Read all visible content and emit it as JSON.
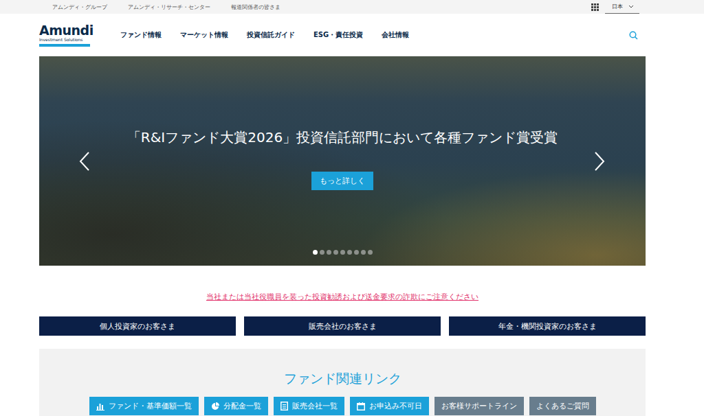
{
  "utility_bar": {
    "links": [
      "アムンディ・グループ",
      "アムンディ・リサーチ・センター",
      "報道関係者の皆さま"
    ],
    "language": "日本"
  },
  "logo": {
    "name": "Amundi",
    "tagline": "Investment Solutions"
  },
  "nav": {
    "items": [
      "ファンド情報",
      "マーケット情報",
      "投資信託ガイド",
      "ESG・責任投資",
      "会社情報"
    ]
  },
  "hero": {
    "heading": "「R&Iファンド大賞2026」投資信託部門において各種ファンド賞受賞",
    "button": "もっと詳しく",
    "slides": [
      {
        "selected": true
      },
      {
        "selected": false
      },
      {
        "selected": false
      },
      {
        "selected": false
      },
      {
        "selected": false
      },
      {
        "selected": false
      },
      {
        "selected": false
      },
      {
        "selected": false
      },
      {
        "selected": false
      }
    ]
  },
  "alert": {
    "text": "当社または当社役職員を装った投資勧誘および送金要求の詐欺にご注意ください"
  },
  "audience_buttons": [
    "個人投資家のお客さま",
    "販売会社のお客さま",
    "年金・機関投資家のお客さま"
  ],
  "fund_links": {
    "title": "ファンド関連リンク",
    "buttons": [
      {
        "label": "ファンド・基準価額一覧",
        "kind": "chart"
      },
      {
        "label": "分配金一覧",
        "kind": "pie"
      },
      {
        "label": "販売会社一覧",
        "kind": "directory"
      },
      {
        "label": "お申込み不可日",
        "kind": "calendar"
      },
      {
        "label": "お客様サポートライン",
        "kind": "plain"
      },
      {
        "label": "よくあるご質問",
        "kind": "plain"
      }
    ]
  }
}
